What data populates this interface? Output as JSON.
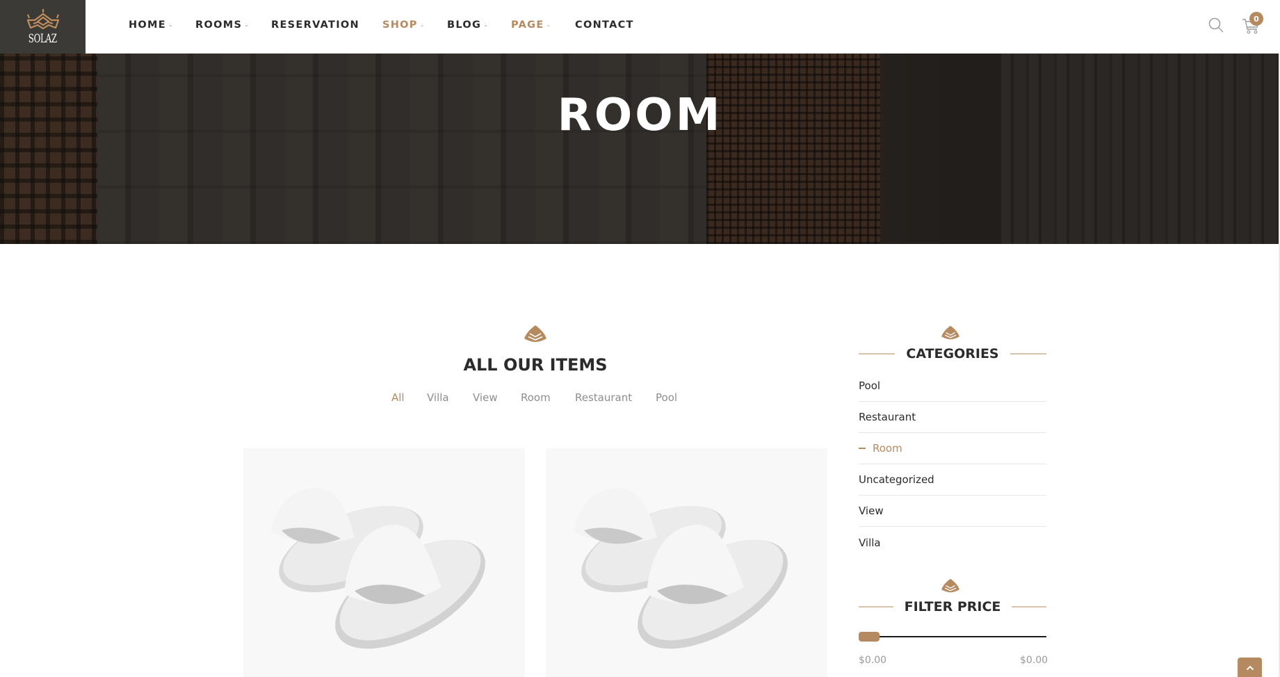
{
  "brand": {
    "name": "SOLAZ",
    "accent_color": "#b68a60",
    "logo_bg": "#3c3a36"
  },
  "nav": {
    "items": [
      {
        "label": "HOME",
        "has_dropdown": true,
        "active": false
      },
      {
        "label": "ROOMS",
        "has_dropdown": true,
        "active": false
      },
      {
        "label": "RESERVATION",
        "has_dropdown": false,
        "active": false
      },
      {
        "label": "SHOP",
        "has_dropdown": true,
        "active": true
      },
      {
        "label": "BLOG",
        "has_dropdown": true,
        "active": false
      },
      {
        "label": "PAGE",
        "has_dropdown": true,
        "active": true
      },
      {
        "label": "CONTACT",
        "has_dropdown": false,
        "active": false
      }
    ],
    "chevron_glyph": "v"
  },
  "header_icons": {
    "search": "search-icon",
    "cart": "cart-icon",
    "cart_count": "0"
  },
  "hero": {
    "title": "ROOM"
  },
  "main": {
    "heading": "ALL OUR ITEMS",
    "filter_tabs": [
      {
        "label": "All",
        "active": true
      },
      {
        "label": "Villa",
        "active": false
      },
      {
        "label": "View",
        "active": false
      },
      {
        "label": "Room",
        "active": false
      },
      {
        "label": "Restaurant",
        "active": false
      },
      {
        "label": "Pool",
        "active": false
      }
    ],
    "products": [
      {
        "image": "white-slippers"
      },
      {
        "image": "white-slippers"
      }
    ]
  },
  "sidebar": {
    "categories": {
      "title": "CATEGORIES",
      "items": [
        {
          "label": "Pool",
          "active": false
        },
        {
          "label": "Restaurant",
          "active": false
        },
        {
          "label": "Room",
          "active": true
        },
        {
          "label": "Uncategorized",
          "active": false
        },
        {
          "label": "View",
          "active": false
        },
        {
          "label": "Villa",
          "active": false
        }
      ]
    },
    "filter_price": {
      "title": "FILTER PRICE",
      "min_label": "$0.00",
      "max_label": "$0.00",
      "range_fraction": [
        0,
        0
      ]
    }
  },
  "scroll_top": {
    "icon": "chevron-up-icon"
  }
}
